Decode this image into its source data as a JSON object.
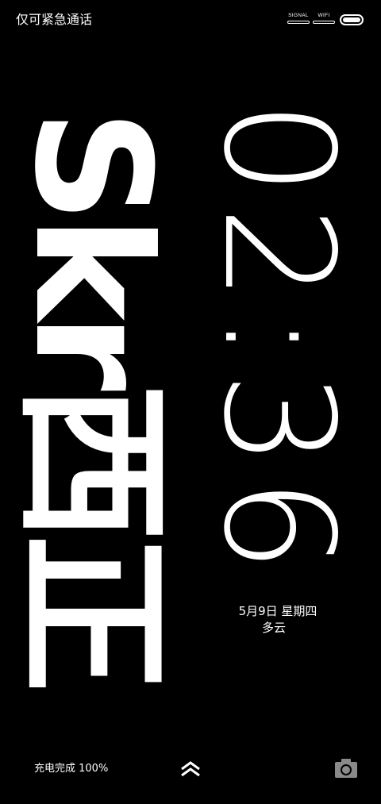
{
  "status_bar": {
    "carrier_text": "仅可紧急通话",
    "signal_label": "SIGNAL",
    "wifi_label": "WIFI",
    "icons": [
      "signal-icon",
      "wifi-icon",
      "battery-icon"
    ]
  },
  "lock_screen": {
    "art_text": "Skr西正",
    "time": "02:36",
    "date": "5月9日 星期四",
    "weather": "多云"
  },
  "bottom_bar": {
    "charge_status": "充电完成 100%",
    "icons": [
      "unlock-chevron-icon",
      "camera-icon"
    ]
  },
  "colors": {
    "background": "#000000",
    "foreground": "#ffffff",
    "camera_icon": "#8a8a8a"
  }
}
